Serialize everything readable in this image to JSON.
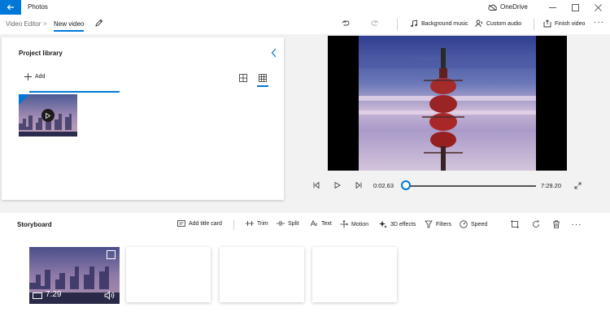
{
  "titlebar": {
    "app_title": "Photos",
    "onedrive_label": "OneDrive",
    "icons": [
      "back-arrow-icon",
      "cloud-icon"
    ],
    "window_controls": [
      "minimize",
      "maximize",
      "close"
    ]
  },
  "command_bar": {
    "breadcrumb_root": "Video Editor",
    "breadcrumb_separator": ">",
    "breadcrumb_current": "New video",
    "background_music": "Background music",
    "custom_audio": "Custom audio",
    "finish_video": "Finish video",
    "icons": [
      "pencil-icon",
      "undo-icon",
      "redo-icon",
      "music-note-icon",
      "custom-audio-icon",
      "export-icon",
      "more-icon"
    ]
  },
  "library": {
    "title": "Project library",
    "add_label": "Add",
    "view_modes": [
      "list-view",
      "grid-view"
    ],
    "selected_view": "grid-view"
  },
  "player": {
    "current_time": "0:02.63",
    "total_time": "7:29.20",
    "progress": 0.006,
    "controls": [
      "previous-frame",
      "play",
      "next-frame",
      "fullscreen"
    ]
  },
  "storyboard": {
    "title": "Storyboard",
    "tools": {
      "add_title_card": "Add title card",
      "trim": "Trim",
      "split": "Split",
      "text": "Text",
      "motion": "Motion",
      "effects_3d": "3D effects",
      "filters": "Filters",
      "speed": "Speed"
    },
    "icon_tools": [
      "crop-icon",
      "rotate-icon",
      "trash-icon",
      "more-icon"
    ],
    "clip": {
      "duration": "7:29",
      "selected": true
    },
    "empty_slots": 3
  },
  "colors": {
    "accent": "#0078d7",
    "panel": "#ffffff",
    "app_background": "#f2f2f2"
  }
}
